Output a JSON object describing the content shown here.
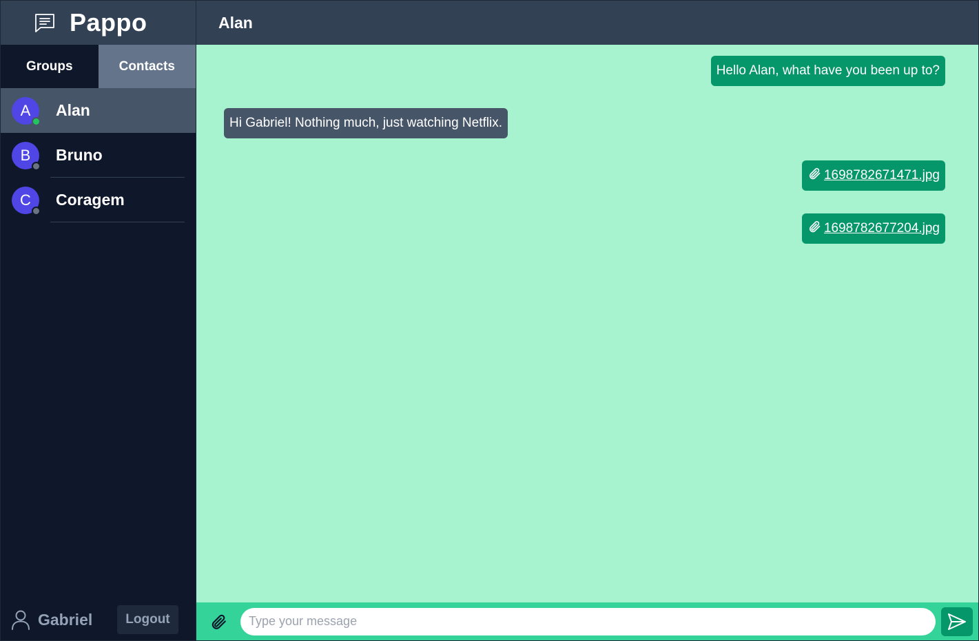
{
  "sidebar": {
    "brand": {
      "name": "Pappo",
      "icon": "chat-bubble-icon"
    },
    "tabs": [
      {
        "label": "Groups"
      },
      {
        "label": "Contacts"
      }
    ],
    "contacts": [
      {
        "initial": "A",
        "name": "Alan",
        "status": "online",
        "status_color": "#22c55e"
      },
      {
        "initial": "B",
        "name": "Bruno",
        "status": "offline",
        "status_color": "#6b7280"
      },
      {
        "initial": "C",
        "name": "Coragem",
        "status": "offline",
        "status_color": "#6b7280"
      }
    ],
    "footer": {
      "username": "Gabriel",
      "logout_label": "Logout",
      "icon": "user-icon"
    }
  },
  "chat": {
    "title": "Alan",
    "messages": [
      {
        "direction": "out",
        "text": "Hello Alan, what have you been up to?"
      },
      {
        "direction": "in",
        "text": "Hi Gabriel! Nothing much, just watching Netflix."
      },
      {
        "direction": "out",
        "file": "1698782671471.jpg",
        "icon": "paperclip-icon"
      },
      {
        "direction": "out",
        "file": "1698782677204.jpg",
        "icon": "paperclip-icon"
      }
    ],
    "composer": {
      "placeholder": "Type your message",
      "value": ""
    }
  },
  "colors": {
    "sidebar_bg": "#0f172a",
    "header_bg": "#334155",
    "chat_bg": "#a7f3d0",
    "outgoing_bubble": "#059669",
    "incoming_bubble": "#475569",
    "composer_bg": "#34d399",
    "avatar": "#4f46e5"
  }
}
